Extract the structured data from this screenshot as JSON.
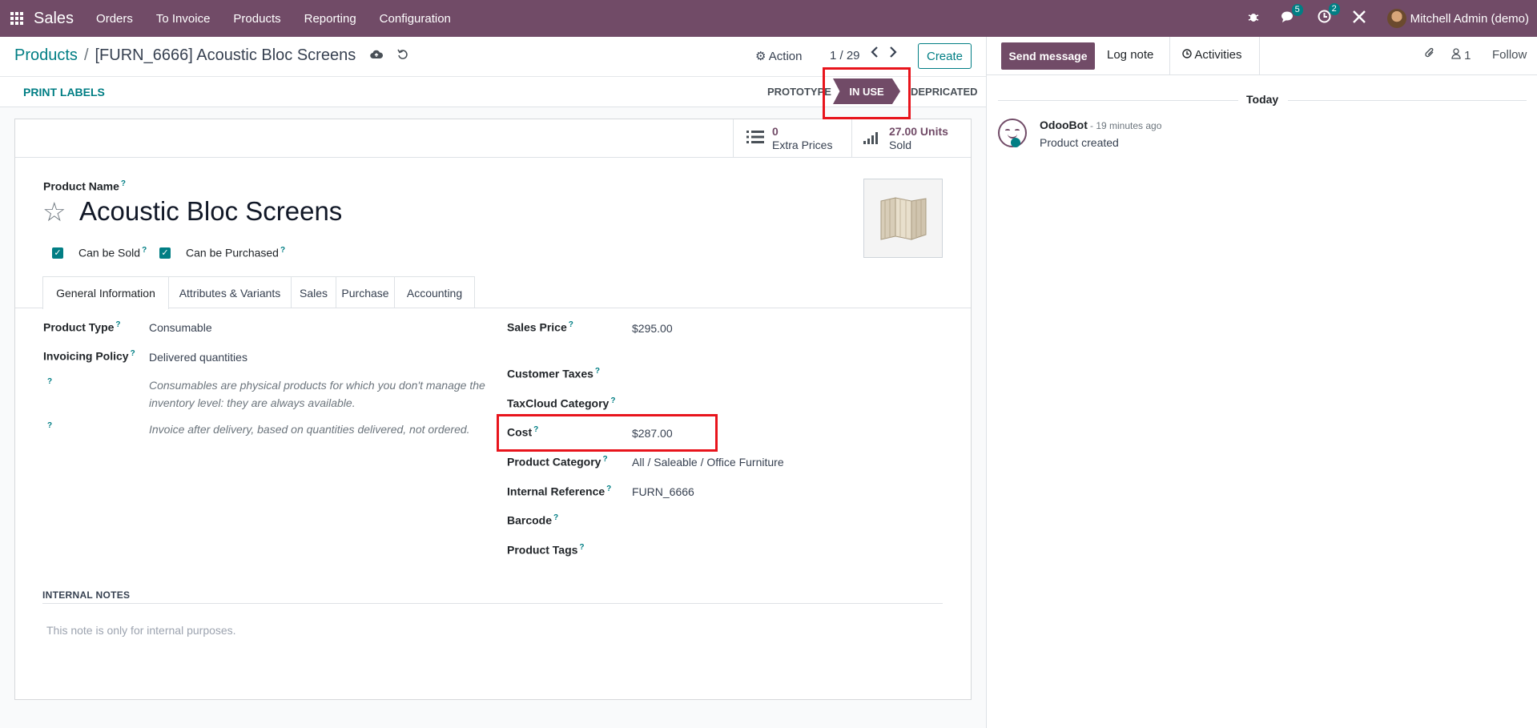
{
  "navbar": {
    "app_name": "Sales",
    "menu": [
      "Orders",
      "To Invoice",
      "Products",
      "Reporting",
      "Configuration"
    ],
    "messages_count": "5",
    "activities_count": "2",
    "user_name": "Mitchell Admin (demo)",
    "icons": [
      "apps-grid-icon",
      "bug-icon",
      "chat-bubbles-icon",
      "clock-icon",
      "tools-icon"
    ]
  },
  "breadcrumb": {
    "parent": "Products",
    "separator": "/",
    "current": "[FURN_6666] Acoustic Bloc Screens"
  },
  "control": {
    "action_label": "Action",
    "pager": "1 / 29",
    "create_label": "Create"
  },
  "statusbar": {
    "print_labels": "PRINT LABELS",
    "stages": [
      "PROTOTYPE",
      "IN USE",
      "DEPRICATED"
    ],
    "active_stage": "IN USE"
  },
  "smart_buttons": {
    "extra_prices_value": "0",
    "extra_prices_label": "Extra Prices",
    "sold_value": "27.00 Units",
    "sold_label": "Sold"
  },
  "product": {
    "name_label": "Product Name",
    "name": "Acoustic Bloc Screens",
    "can_be_sold_label": "Can be Sold",
    "can_be_purchased_label": "Can be Purchased",
    "can_be_sold": true,
    "can_be_purchased": true
  },
  "tabs": [
    "General Information",
    "Attributes & Variants",
    "Sales",
    "Purchase",
    "Accounting"
  ],
  "general": {
    "product_type_label": "Product Type",
    "product_type": "Consumable",
    "invoicing_policy_label": "Invoicing Policy",
    "invoicing_policy": "Delivered quantities",
    "type_help": "Consumables are physical products for which you don't manage the inventory level: they are always available.",
    "policy_help": "Invoice after delivery, based on quantities delivered, not ordered.",
    "sales_price_label": "Sales Price",
    "sales_price": "$295.00",
    "customer_taxes_label": "Customer Taxes",
    "taxcloud_category_label": "TaxCloud Category",
    "cost_label": "Cost",
    "cost": "$287.00",
    "product_category_label": "Product Category",
    "product_category": "All / Saleable / Office Furniture",
    "internal_reference_label": "Internal Reference",
    "internal_reference": "FURN_6666",
    "barcode_label": "Barcode",
    "product_tags_label": "Product Tags"
  },
  "internal_notes": {
    "label": "INTERNAL NOTES",
    "placeholder": "This note is only for internal purposes."
  },
  "chatter": {
    "send_message": "Send message",
    "log_note": "Log note",
    "activities": "Activities",
    "followers_count": "1",
    "follow": "Follow",
    "today": "Today",
    "message": {
      "author": "OdooBot",
      "time": "- 19 minutes ago",
      "body": "Product created"
    }
  },
  "colors": {
    "brand": "#714b67",
    "accent": "#017e84",
    "highlight": "#e8141c"
  }
}
